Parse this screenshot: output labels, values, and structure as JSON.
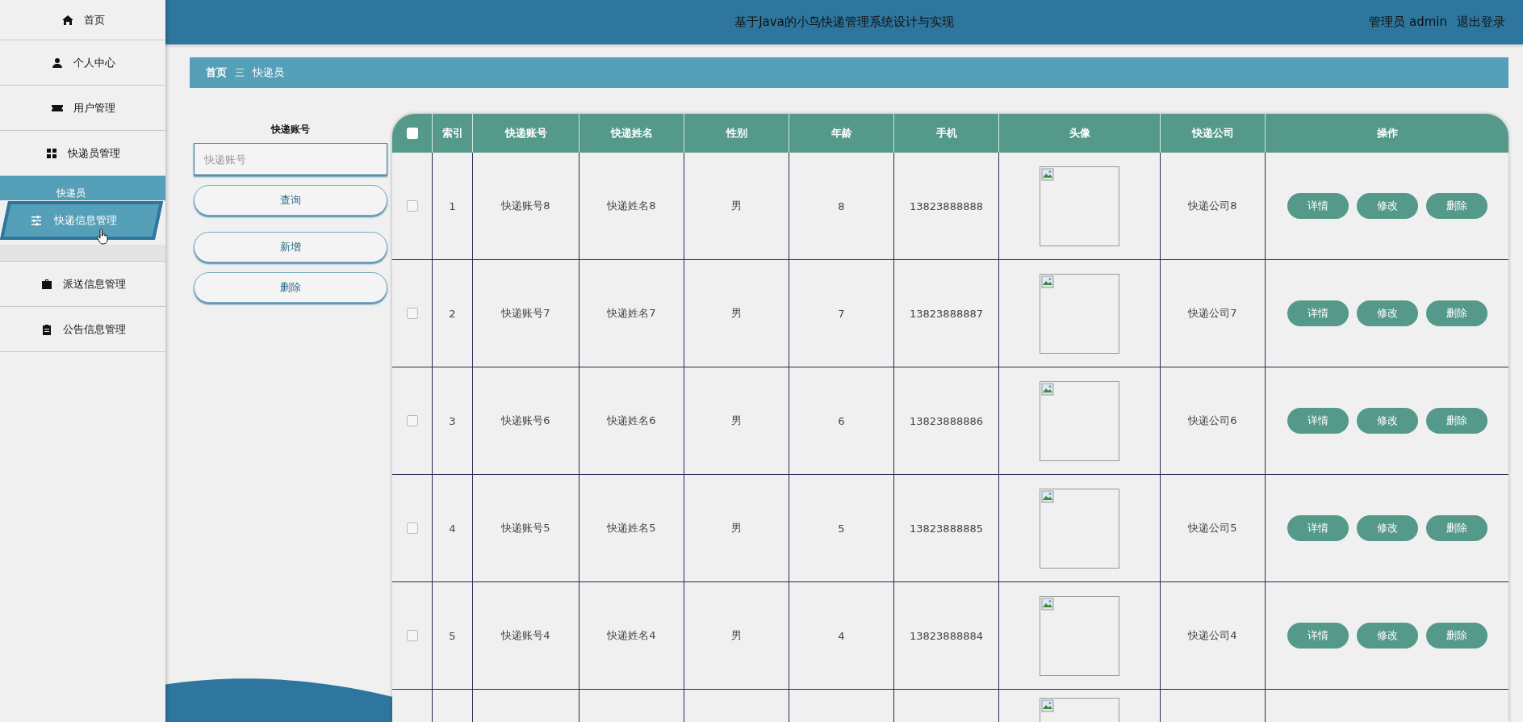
{
  "header": {
    "title": "基于Java的小鸟快递管理系统设计与实现",
    "user": "管理员 admin",
    "logout": "退出登录"
  },
  "sidebar": {
    "items": [
      {
        "kind": "item",
        "label": "首页"
      },
      {
        "kind": "item",
        "label": "个人中心"
      },
      {
        "kind": "item",
        "label": "用户管理"
      },
      {
        "kind": "item",
        "label": "快递员管理"
      },
      {
        "kind": "group",
        "label": "快递员"
      },
      {
        "kind": "subitem",
        "label": "快递信息管理",
        "hovered": true
      },
      {
        "kind": "gap"
      },
      {
        "kind": "item",
        "label": "派送信息管理"
      },
      {
        "kind": "item",
        "label": "公告信息管理"
      }
    ]
  },
  "breadcrumb": {
    "items": [
      "首页",
      "快递员"
    ],
    "separator": "三"
  },
  "search": {
    "label": "快递账号",
    "placeholder": "快递账号",
    "buttons": [
      "查询",
      "新增",
      "删除"
    ]
  },
  "table": {
    "all_checked": false,
    "columns": [
      "索引",
      "快递账号",
      "快递姓名",
      "性别",
      "年龄",
      "手机",
      "头像",
      "快递公司",
      "操作"
    ],
    "rows": [
      {
        "kind": "row",
        "checked": false,
        "cells": [
          "1",
          "快递账号8",
          "快递姓名8",
          "男",
          "8",
          "13823888888"
        ],
        "company": "快递公司8",
        "actions": [
          "详情",
          "修改",
          "删除"
        ]
      },
      {
        "kind": "row",
        "checked": false,
        "cells": [
          "2",
          "快递账号7",
          "快递姓名7",
          "男",
          "7",
          "13823888887"
        ],
        "company": "快递公司7",
        "actions": [
          "详情",
          "修改",
          "删除"
        ]
      },
      {
        "kind": "row",
        "checked": false,
        "cells": [
          "3",
          "快递账号6",
          "快递姓名6",
          "男",
          "6",
          "13823888886"
        ],
        "company": "快递公司6",
        "actions": [
          "详情",
          "修改",
          "删除"
        ]
      },
      {
        "kind": "row",
        "checked": false,
        "cells": [
          "4",
          "快递账号5",
          "快递姓名5",
          "男",
          "5",
          "13823888885"
        ],
        "company": "快递公司5",
        "actions": [
          "详情",
          "修改",
          "删除"
        ]
      },
      {
        "kind": "row",
        "checked": false,
        "cells": [
          "5",
          "快递账号4",
          "快递姓名4",
          "男",
          "4",
          "13823888884"
        ],
        "company": "快递公司4",
        "actions": [
          "详情",
          "修改",
          "删除"
        ]
      },
      {
        "kind": "cut"
      }
    ]
  }
}
